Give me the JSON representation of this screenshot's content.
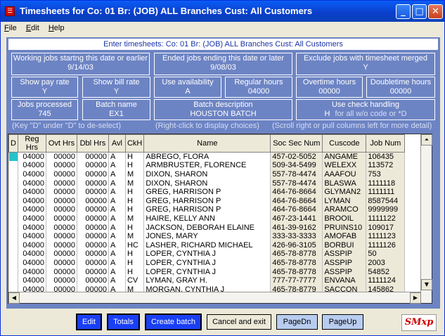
{
  "window": {
    "title": "Timesheets for Co: 01  Br:  (JOB) ALL Branches  Cust: All Customers",
    "icon": "app-icon"
  },
  "menu": [
    {
      "label": "File"
    },
    {
      "label": "Edit"
    },
    {
      "label": "Help"
    }
  ],
  "header": {
    "text": "Enter timesheets: Co: 01     Br:  (JOB) ALL Branches     Cust: All Customers"
  },
  "fields": {
    "working_jobs": {
      "label": "Working jobs startng this date or earlier",
      "value": "9/14/03"
    },
    "ended_jobs": {
      "label": "Ended jobs ending this date or later",
      "value": "9/08/03"
    },
    "exclude_merged": {
      "label": "Exclude jobs with timesheet merged",
      "value": "Y"
    },
    "show_pay_rate": {
      "label": "Show pay rate",
      "value": "Y"
    },
    "show_bill_rate": {
      "label": "Show bill rate",
      "value": "Y"
    },
    "use_availability": {
      "label": "Use availability",
      "value": "A"
    },
    "regular_hours": {
      "label": "Regular hours",
      "value": "04000"
    },
    "overtime_hours": {
      "label": "Overtime hours",
      "value": "00000"
    },
    "doubletime_hours": {
      "label": "Doubletime hours",
      "value": "00000"
    },
    "jobs_processed": {
      "label": "Jobs processed",
      "value": "745"
    },
    "batch_name": {
      "label": "Batch name",
      "value": "EX1"
    },
    "batch_description": {
      "label": "Batch description",
      "value": "HOUSTON BATCH"
    },
    "check_handling": {
      "label": "Use check handling",
      "value": "H",
      "note": "for all w/o code or *D"
    }
  },
  "hints": {
    "left": "(Key \"D\" under \"D\" to de-select)",
    "middle": "(Right-click to display choices)",
    "right": "(Scroll right or pull columns left for more detail)"
  },
  "columns": [
    "D",
    "Reg Hrs",
    "Ovt Hrs",
    "Dbl Hrs",
    "Avl",
    "CkH",
    "Name",
    "Soc Sec Num",
    "Cuscode",
    "Job Num"
  ],
  "rows": [
    [
      "",
      "04000",
      "00000",
      "00000",
      "A",
      "H",
      "ABREGO, FLORA",
      "457-02-5052",
      "ANGAME",
      "106435"
    ],
    [
      "",
      "04000",
      "00000",
      "00000",
      "A",
      "H",
      "ARMBRUSTER, FLORENCE",
      "509-34-5499",
      "WELEXX",
      "113572"
    ],
    [
      "",
      "04000",
      "00000",
      "00000",
      "A",
      "M",
      "DIXON, SHARON",
      "557-78-4474",
      "AAAFOU",
      "753"
    ],
    [
      "",
      "04000",
      "00000",
      "00000",
      "A",
      "M",
      "DIXON, SHARON",
      "557-78-4474",
      "BLASWA",
      "1111118"
    ],
    [
      "",
      "04000",
      "00000",
      "00000",
      "A",
      "H",
      "GREG, HARRISON P",
      "464-76-8664",
      "GLYMAN2",
      "1111111"
    ],
    [
      "",
      "04000",
      "00000",
      "00000",
      "A",
      "H",
      "GREG, HARRISON P",
      "464-76-8664",
      "LYMAN",
      "8587544"
    ],
    [
      "",
      "04000",
      "00000",
      "00000",
      "A",
      "H",
      "GREG, HARRISON P",
      "464-76-8664",
      "ARAMCO",
      "9999999"
    ],
    [
      "",
      "04000",
      "00000",
      "00000",
      "A",
      "M",
      "HAIRE, KELLY ANN",
      "467-23-1441",
      "BROOIL",
      "1111122"
    ],
    [
      "",
      "04000",
      "00000",
      "00000",
      "A",
      "H",
      "JACKSON, DEBORAH ELAINE",
      "461-39-9162",
      "PRUINS10",
      "109017"
    ],
    [
      "",
      "04000",
      "00000",
      "00000",
      "A",
      "M",
      "JONES, MARY",
      "333-33-3333",
      "AMOFAB",
      "1111123"
    ],
    [
      "",
      "04000",
      "00000",
      "00000",
      "A",
      "HC",
      "LASHER, RICHARD MICHAEL",
      "426-96-3105",
      "BORBUI",
      "1111126"
    ],
    [
      "",
      "04000",
      "00000",
      "00000",
      "A",
      "H",
      "LOPER, CYNTHIA J",
      "465-78-8778",
      "ASSPIP",
      "50"
    ],
    [
      "",
      "04000",
      "00000",
      "00000",
      "A",
      "H",
      "LOPER, CYNTHIA J",
      "465-78-8778",
      "ASSPIP",
      "2003"
    ],
    [
      "",
      "04000",
      "00000",
      "00000",
      "A",
      "H",
      "LOPER, CYNTHIA J",
      "465-78-8778",
      "ASSPIP",
      "54852"
    ],
    [
      "",
      "04000",
      "00000",
      "00000",
      "A",
      "CV",
      "LYMAN, GRAY H.",
      "777-77-7777",
      "ENVANA",
      "1111124"
    ],
    [
      "",
      "04000",
      "00000",
      "00000",
      "A",
      "M",
      "MORGAN, CYNTHIA J",
      "465-78-8779",
      "SACCON",
      "145862"
    ]
  ],
  "buttons": {
    "edit": "Edit",
    "totals": "Totals",
    "create_batch": "Create batch",
    "cancel_exit": "Cancel and exit",
    "page_dn": "PageDn",
    "page_up": "PageUp"
  },
  "logo": "SMxp"
}
